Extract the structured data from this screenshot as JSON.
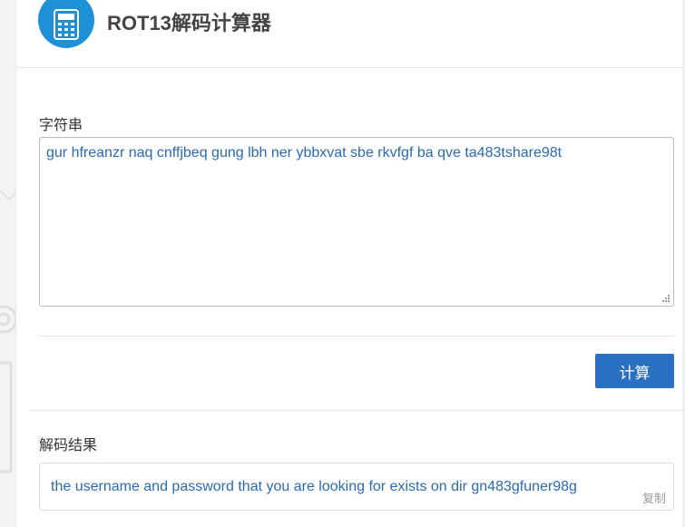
{
  "header": {
    "title": "ROT13解码计算器",
    "logo_icon": "calculator-icon"
  },
  "input_section": {
    "label": "字符串",
    "value": "gur hfreanzr naq cnffjbeq gung lbh ner ybbxvat sbe rkvfgf ba qve ta483tshare98t"
  },
  "actions": {
    "calculate_label": "计算"
  },
  "result_section": {
    "label": "解码结果",
    "value": "the username and password that you are looking for exists on dir gn483gfuner98g",
    "copy_label": "复制"
  },
  "colors": {
    "accent": "#2a70c2",
    "logo_bg": "#1e90d6",
    "text_value": "#2a6bb0"
  }
}
